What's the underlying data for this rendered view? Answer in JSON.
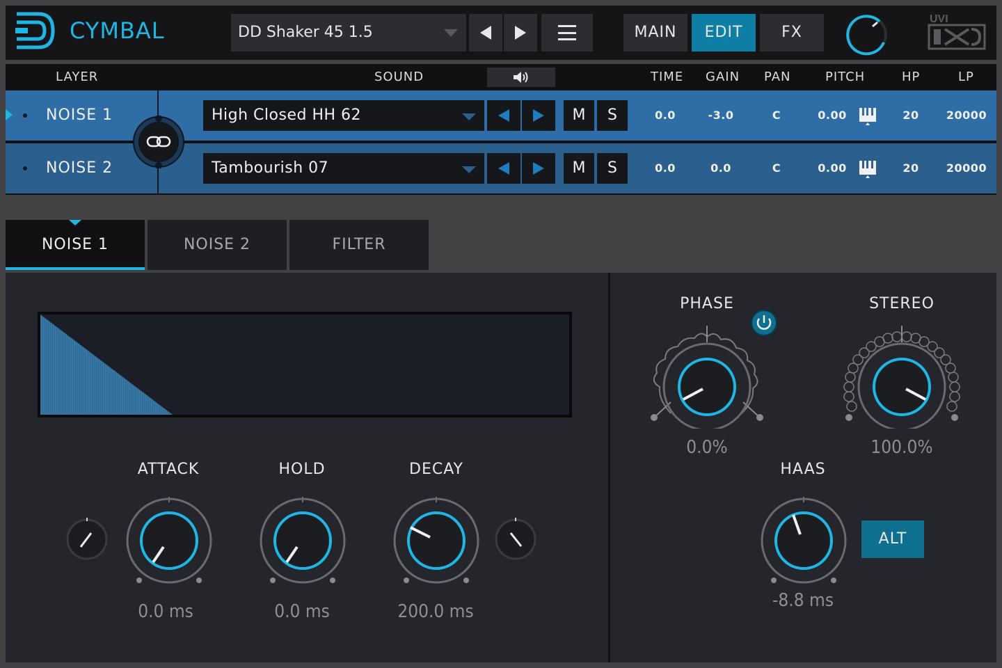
{
  "app": {
    "title": "CYMBAL",
    "brand": "UVI"
  },
  "toolbar": {
    "preset_name": "DD Shaker 45 1.5",
    "nav": [
      "MAIN",
      "EDIT",
      "FX"
    ],
    "active_nav": "EDIT"
  },
  "layers": {
    "headers": {
      "layer": "LAYER",
      "sound": "SOUND",
      "time": "TIME",
      "gain": "GAIN",
      "pan": "PAN",
      "pitch": "PITCH",
      "hp": "HP",
      "lp": "LP"
    },
    "rows": [
      {
        "name": "NOISE 1",
        "sound": "High Closed HH 62",
        "mute": "M",
        "solo": "S",
        "time": "0.0",
        "gain": "-3.0",
        "pan": "C",
        "pitch": "0.00",
        "hp": "20",
        "lp": "20000"
      },
      {
        "name": "NOISE 2",
        "sound": "Tambourish 07",
        "mute": "M",
        "solo": "S",
        "time": "0.0",
        "gain": "0.0",
        "pan": "C",
        "pitch": "0.00",
        "hp": "20",
        "lp": "20000"
      }
    ]
  },
  "tabs": [
    "NOISE 1",
    "NOISE 2",
    "FILTER"
  ],
  "active_tab": "NOISE 1",
  "envelope": {
    "attack": {
      "label": "ATTACK",
      "value": "0.0 ms"
    },
    "hold": {
      "label": "HOLD",
      "value": "0.0 ms"
    },
    "decay": {
      "label": "DECAY",
      "value": "200.0 ms"
    }
  },
  "stereo": {
    "phase": {
      "label": "PHASE",
      "value": "0.0%"
    },
    "stereo": {
      "label": "STEREO",
      "value": "100.0%"
    },
    "haas": {
      "label": "HAAS",
      "value": "-8.8 ms"
    },
    "alt_label": "ALT"
  },
  "colors": {
    "accent": "#1fb6e6",
    "row_selected": "#2e6da6",
    "row": "#2a5f8e",
    "panel": "#25262b"
  }
}
